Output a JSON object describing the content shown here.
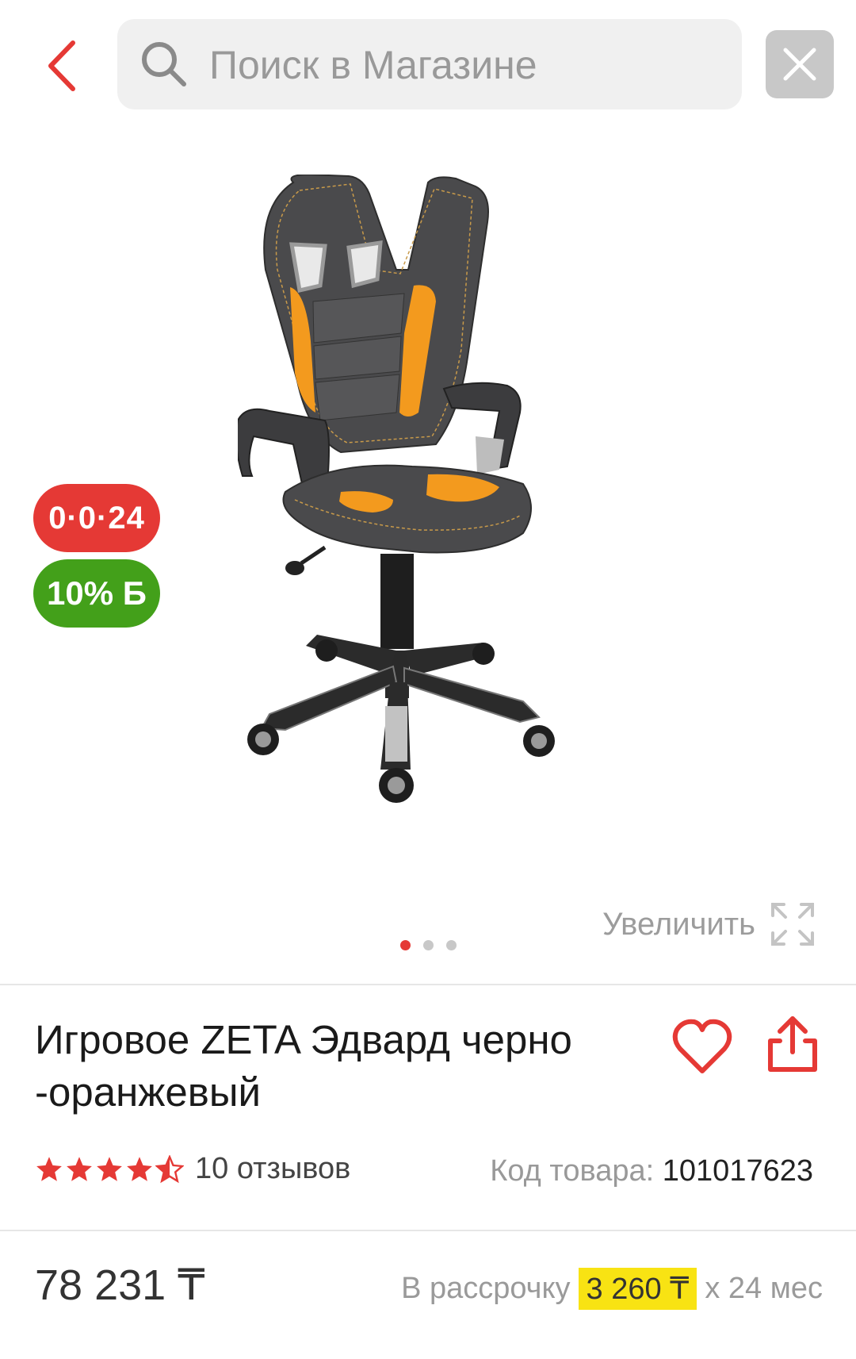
{
  "header": {
    "search_placeholder": "Поиск в Магазине"
  },
  "gallery": {
    "badges": {
      "installment": "0·0·24",
      "bonus": "10% Б"
    },
    "zoom_label": "Увеличить",
    "slides_total": 3,
    "active_slide": 1
  },
  "product": {
    "title": "Игровое ZETA Эдвард черно -оранжевый",
    "rating": 4.5,
    "reviews_label": "10 отзывов",
    "sku_label": "Код товара:",
    "sku_value": "101017623",
    "price": "78 231 ₸",
    "installment_prefix": "В рассрочку",
    "installment_amount": "3 260 ₸",
    "installment_suffix": "х 24 мес"
  },
  "colors": {
    "accent": "#e53935",
    "bonus_green": "#43a01a",
    "highlight": "#f8e313",
    "chair_orange": "#f39a1e"
  }
}
